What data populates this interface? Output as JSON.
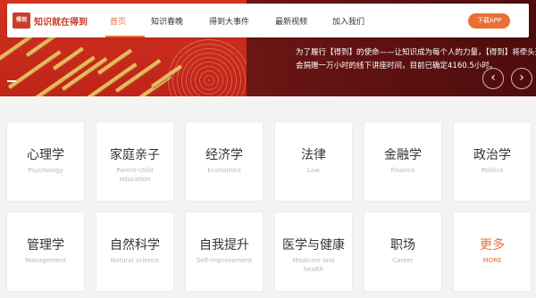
{
  "brand": {
    "logo_mark": "得到",
    "name": "知识就在得到"
  },
  "nav": {
    "items": [
      "首页",
      "知识春晚",
      "得到大事件",
      "最新视频",
      "加入我们"
    ],
    "active_index": 0,
    "download_label": "下载APP"
  },
  "hero": {
    "line1": "为了履行【得到】的使命——让知识成为每个人的力量，【得到】将牵头这项知",
    "line2": "会捐赠一万小时的线下讲座时间，目前已确定4160.5小时。",
    "prev_icon": "‹",
    "next_icon": "›"
  },
  "categories": [
    {
      "zh": "心理学",
      "en": "Psychology"
    },
    {
      "zh": "家庭亲子",
      "en": "Parent-child education"
    },
    {
      "zh": "经济学",
      "en": "Economics"
    },
    {
      "zh": "法律",
      "en": "Law"
    },
    {
      "zh": "金融学",
      "en": "Finance"
    },
    {
      "zh": "政治学",
      "en": "Politics"
    },
    {
      "zh": "管理学",
      "en": "Management"
    },
    {
      "zh": "自然科学",
      "en": "Natural science"
    },
    {
      "zh": "自我提升",
      "en": "Self-improvement"
    },
    {
      "zh": "医学与健康",
      "en": "Medicine and health"
    },
    {
      "zh": "职场",
      "en": "Career"
    },
    {
      "zh": "更多",
      "en": "MORE"
    }
  ],
  "colors": {
    "accent": "#ea6f34",
    "brand_red": "#c8402a"
  }
}
